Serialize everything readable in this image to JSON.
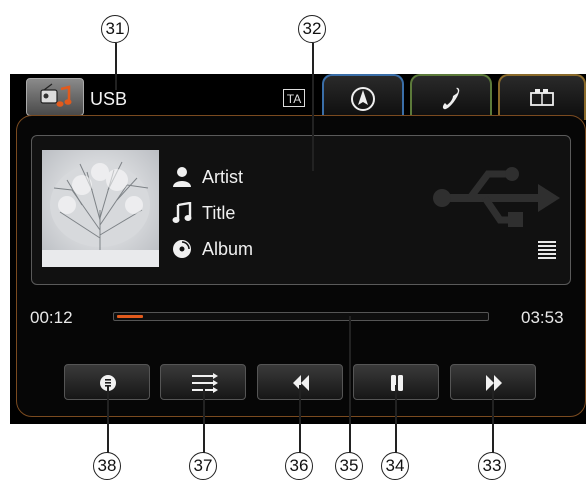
{
  "source": {
    "label": "USB"
  },
  "ta_label": "TA",
  "track": {
    "artist_label": "Artist",
    "title_label": "Title",
    "album_label": "Album"
  },
  "playback": {
    "elapsed": "00:12",
    "total": "03:53",
    "progress_fraction": 0.07
  },
  "tabs": [
    {
      "name": "navigation",
      "icon": "navigation-icon",
      "border": "#3a6ea8"
    },
    {
      "name": "phone",
      "icon": "phone-icon",
      "border": "#5c7a3a"
    },
    {
      "name": "car",
      "icon": "car-settings-icon",
      "border": "#8a6a2a"
    }
  ],
  "controls": [
    "source-info-icon",
    "playlist-icon",
    "previous-track-icon",
    "pause-icon",
    "next-track-icon"
  ],
  "callouts": {
    "c31": "31",
    "c32": "32",
    "c33": "33",
    "c34": "34",
    "c35": "35",
    "c36": "36",
    "c37": "37",
    "c38": "38"
  },
  "colors": {
    "accent": "#e25a1c",
    "panel_border": "#7a4a1f"
  }
}
